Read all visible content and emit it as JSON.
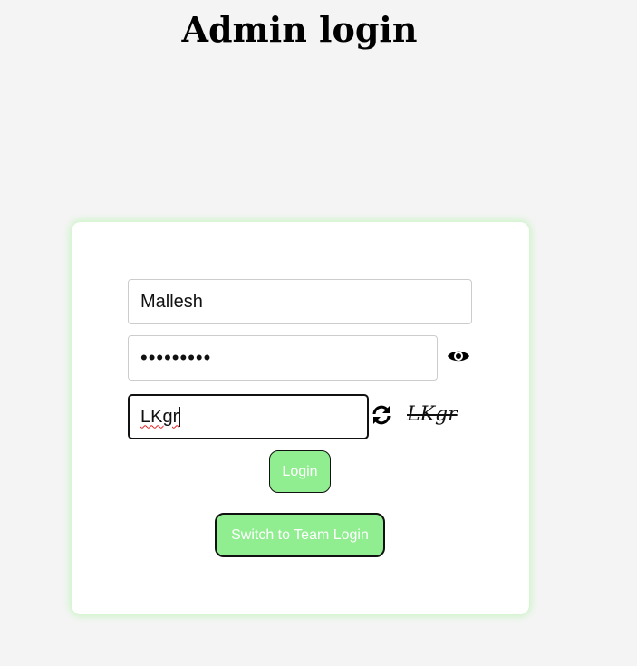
{
  "page": {
    "title": "Admin login"
  },
  "form": {
    "username_value": "Mallesh",
    "password_value": "•••••••••",
    "captcha_input_value": "LKgr",
    "captcha_code": "LKgr",
    "login_label": "Login",
    "switch_label": "Switch to Team Login"
  },
  "icons": {
    "eye": "eye-icon",
    "refresh": "refresh-icon"
  },
  "colors": {
    "page_bg": "#f4f4f4",
    "card_bg": "#ffffff",
    "card_glow": "#c8f5c2",
    "button_bg": "#90ee90",
    "button_text": "#ffffff"
  }
}
